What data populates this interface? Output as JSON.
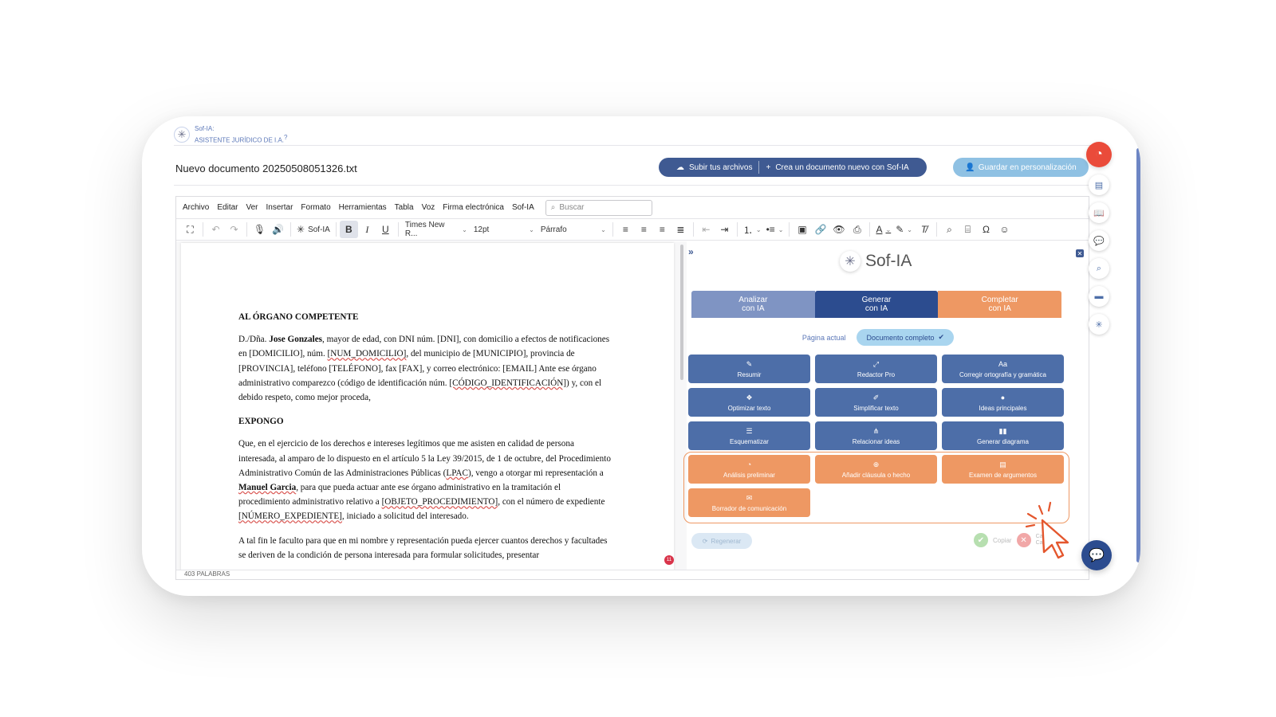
{
  "brand": {
    "line1": "Sof-IA:",
    "line2": "ASISTENTE JURÍDICO DE I.A.",
    "help": "?"
  },
  "document": {
    "title": "Nuevo documento 20250508051326.txt"
  },
  "header_buttons": {
    "upload": "Subir tus archivos",
    "create": "Crea un documento nuevo con Sof-IA",
    "save": "Guardar en personalización"
  },
  "menu": {
    "items": [
      "Archivo",
      "Editar",
      "Ver",
      "Insertar",
      "Formato",
      "Herramientas",
      "Tabla",
      "Voz",
      "Firma electrónica",
      "Sof-IA"
    ],
    "search_placeholder": "Buscar"
  },
  "toolbar": {
    "sofia_label": "Sof-IA",
    "font_family": "Times New R...",
    "font_size": "12pt",
    "block_format": "Párrafo"
  },
  "page": {
    "heading1": "AL ÓRGANO COMPETENTE",
    "p1": {
      "a": "D./Dña. ",
      "name": "Jose Gonzales",
      "b": ", mayor de edad, con DNI núm. [DNI], con domicilio a efectos de notificaciones en [DOMICILIO], núm. ",
      "ph1": "[NUM_DOMICILIO]",
      "c": ", del municipio de [MUNICIPIO], provincia de [PROVINCIA], teléfono [TELÉFONO], fax [FAX], y correo electrónico: [EMAIL] Ante ese órgano administrativo comparezco (código de identificación núm. ",
      "ph2": "[CÓDIGO_IDENTIFICACIÓN]",
      "d": ") y, con el debido respeto, como mejor proceda,"
    },
    "heading2": "EXPONGO",
    "p2": {
      "a": "Que, en el ejercicio de los derechos e intereses legítimos que me asisten en calidad de persona interesada, al amparo de lo dispuesto en el artículo 5 la Ley 39/2015, de 1 de octubre, del Procedimiento Administrativo Común de las Administraciones Públicas (",
      "ph1": "LPAC",
      "b": "), vengo a otorgar mi representación a ",
      "name": "Manuel Garcia",
      "c": ", para que pueda actuar ante ese órgano administrativo en la tramitación el procedimiento administrativo relativo a ",
      "ph2": "[OBJETO_PROCEDIMIENTO]",
      "d": ", con el número de expediente ",
      "ph3": "[NÚMERO_EXPEDIENTE]",
      "e": ", iniciado a solicitud del interesado."
    },
    "p3": "A tal fin le faculto para que en mi nombre y representación pueda ejercer cuantos derechos y facultades se deriven de la condición de persona interesada para formular solicitudes, presentar",
    "notification_count": "11"
  },
  "status": {
    "word_count": "403 PALABRAS"
  },
  "panel": {
    "title": "Sof-IA",
    "tabs": [
      {
        "l1": "Analizar",
        "l2": "con IA"
      },
      {
        "l1": "Generar",
        "l2": "con IA"
      },
      {
        "l1": "Completar",
        "l2": "con IA"
      }
    ],
    "scope": {
      "current_page": "Página actual",
      "full_document": "Documento completo"
    },
    "actions": [
      {
        "label": "Resumir",
        "icon": "✎"
      },
      {
        "label": "Redactor Pro",
        "icon": "⤢"
      },
      {
        "label": "Corregir ortografía y gramática",
        "icon": "Aa"
      },
      {
        "label": "Optimizar texto",
        "icon": "❖"
      },
      {
        "label": "Simplificar texto",
        "icon": "✐"
      },
      {
        "label": "Ideas principales",
        "icon": "●"
      },
      {
        "label": "Esquematizar",
        "icon": "☰"
      },
      {
        "label": "Relacionar ideas",
        "icon": "⋔"
      },
      {
        "label": "Generar diagrama",
        "icon": "▮▮"
      }
    ],
    "complete_actions": [
      {
        "label": "Análisis preliminar",
        "icon": "◔"
      },
      {
        "label": "Añadir cláusula o hecho",
        "icon": "⊕"
      },
      {
        "label": "Examen de argumentos",
        "icon": "▤"
      },
      {
        "label": "Borrador de comunicación",
        "icon": "✉"
      }
    ],
    "regenerate": "Regenerar",
    "copy": "Copiar",
    "cancel": "Ca... Cambios"
  },
  "colors": {
    "primary": "#2c4c8f",
    "action_blue": "#4d6ea8",
    "orange": "#ee9863",
    "light_blue": "#8fc1e3",
    "red": "#ea4b3a"
  }
}
